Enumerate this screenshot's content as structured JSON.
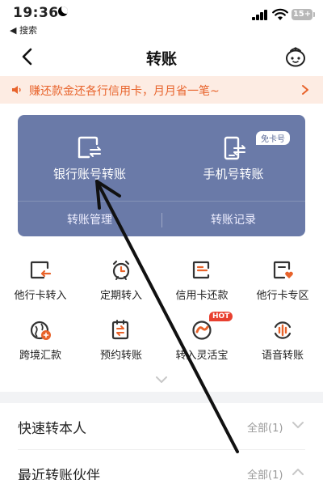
{
  "status_bar": {
    "time": "19:36",
    "back_app": "◀ 搜索",
    "battery": "15+"
  },
  "nav": {
    "title": "转账"
  },
  "banner": {
    "text": "赚还款金还各行信用卡，月月省一笔~"
  },
  "card": {
    "items": [
      {
        "label": "银行账号转账",
        "icon": "bank-card-transfer-icon"
      },
      {
        "label": "手机号转账",
        "icon": "phone-transfer-icon",
        "badge": "免卡号"
      }
    ],
    "bottom": [
      {
        "label": "转账管理"
      },
      {
        "label": "转账记录"
      }
    ]
  },
  "grid": [
    {
      "label": "他行卡转入",
      "icon": "card-import-icon"
    },
    {
      "label": "定期转入",
      "icon": "alarm-clock-icon"
    },
    {
      "label": "信用卡还款",
      "icon": "credit-card-icon"
    },
    {
      "label": "他行卡专区",
      "icon": "card-heart-icon"
    },
    {
      "label": "跨境汇款",
      "icon": "globe-remit-icon"
    },
    {
      "label": "预约转账",
      "icon": "schedule-doc-icon"
    },
    {
      "label": "转入灵活宝",
      "icon": "flexible-treasure-icon",
      "badge": "HOT"
    },
    {
      "label": "语音转账",
      "icon": "voice-transfer-icon"
    }
  ],
  "rows": [
    {
      "label": "快速转本人",
      "value": "全部(1)",
      "chevron": "chevron-down"
    },
    {
      "label": "最近转账伙伴",
      "value": "全部(1)",
      "chevron": "chevron-up"
    }
  ],
  "colors": {
    "card_blue": "#6a7aa8",
    "accent_orange": "#e8632b",
    "icon_dark": "#333333",
    "hot_red": "#e84030"
  }
}
